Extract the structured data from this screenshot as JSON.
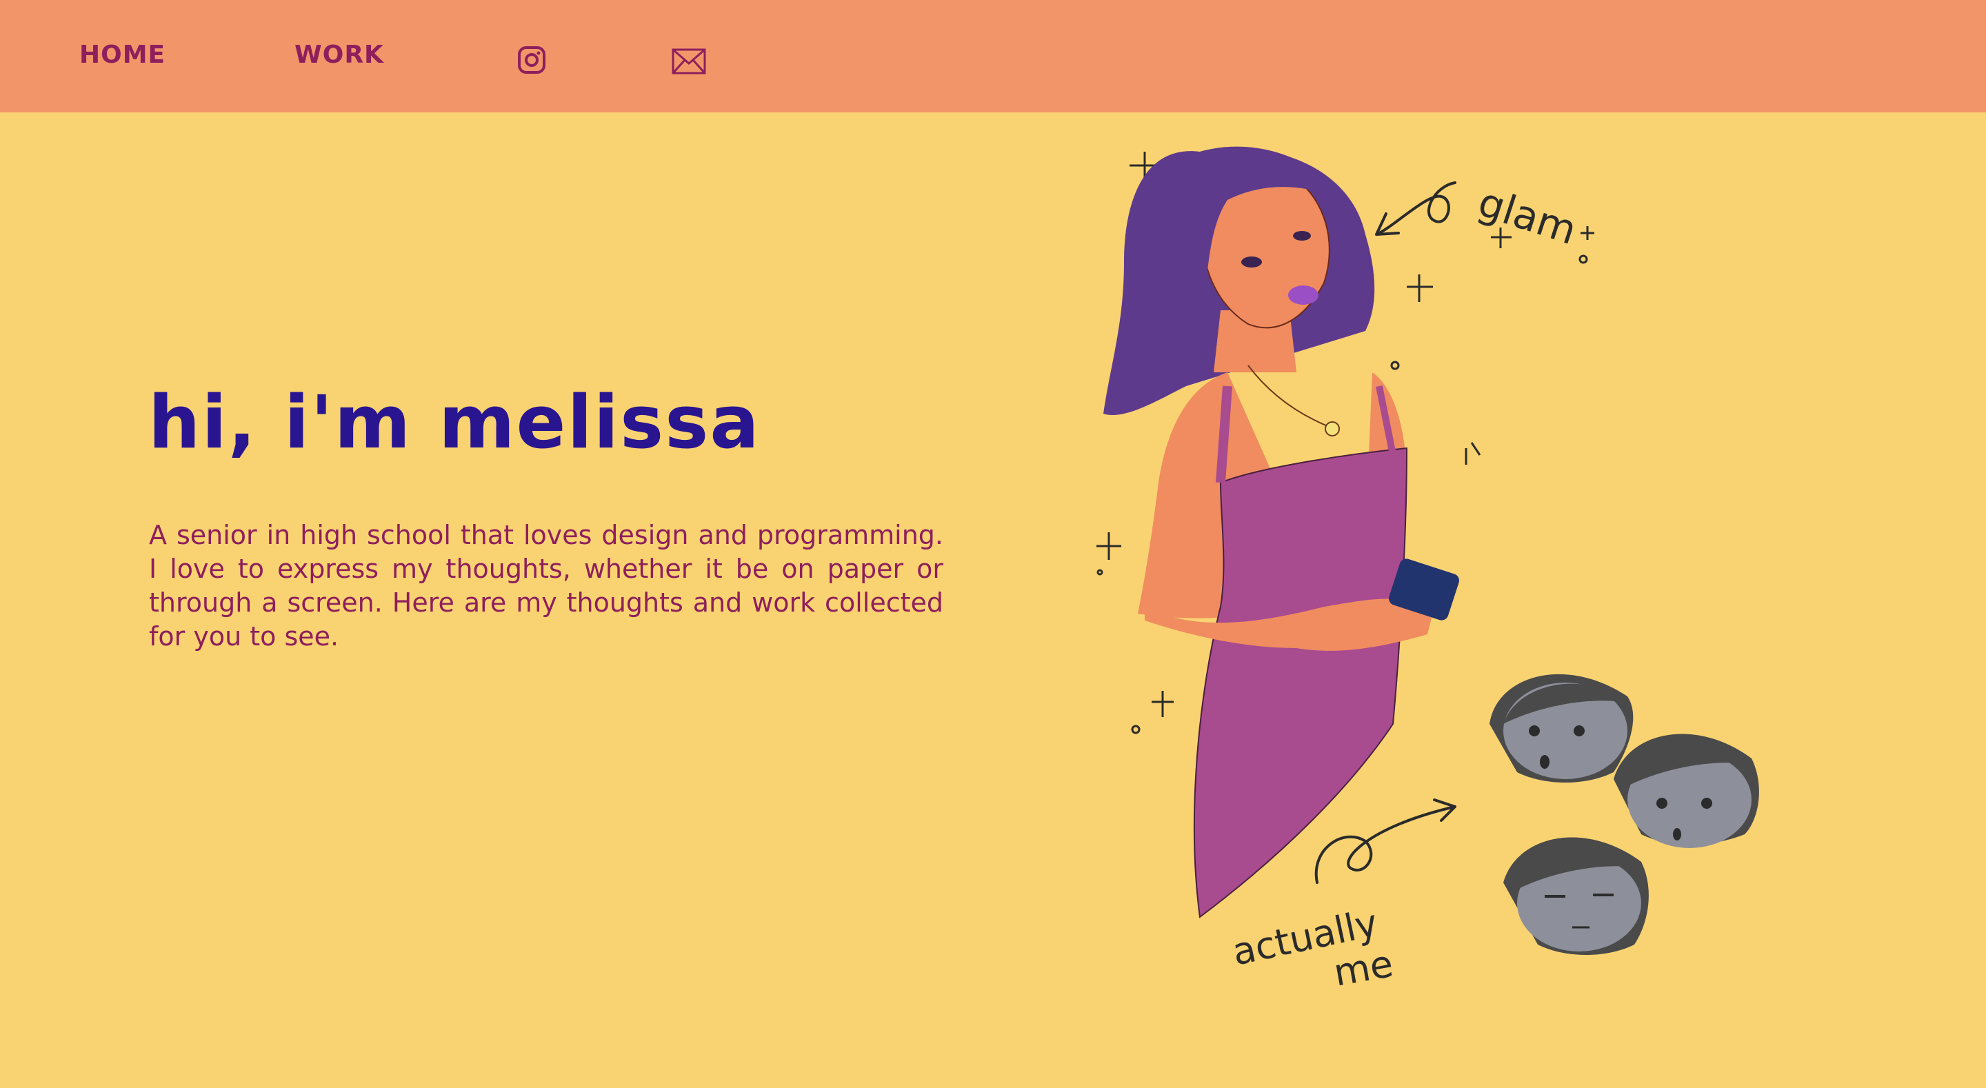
{
  "nav": {
    "home_label": "HOME",
    "work_label": "WORK",
    "instagram_icon": "instagram-icon",
    "mail_icon": "mail-icon"
  },
  "hero": {
    "title": "hi, i'm melissa",
    "description": "A senior in high school that loves design and programming. I love to express my thoughts, whether it be on paper or through a screen. Here are my thoughts and work collected for you to see."
  },
  "illustration": {
    "annotation_glam": "glam",
    "annotation_actually": "actually",
    "annotation_me": "me"
  },
  "colors": {
    "background": "#f9d371",
    "navbar": "#f2966a",
    "nav_text": "#8e1f5c",
    "title": "#2a1591",
    "body_text": "#8e1f5c",
    "dress": "#a94b8f",
    "hair": "#5e3a8c"
  }
}
